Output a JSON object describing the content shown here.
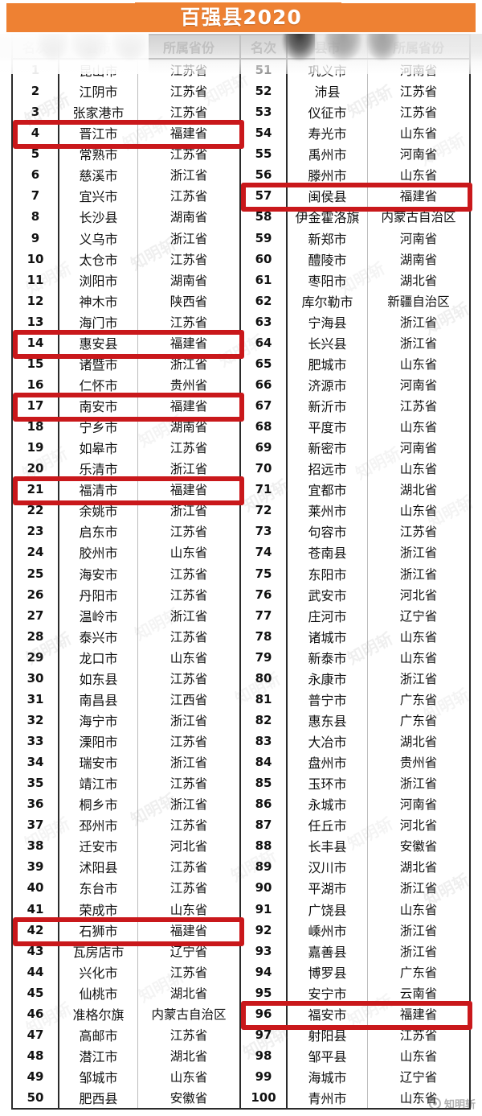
{
  "banner": {
    "title": "百强县2020",
    "background_color": "#ee8133",
    "title_color": "#ffffff"
  },
  "table": {
    "headers": {
      "rank": "名次",
      "city": "县市",
      "province": "所属省份"
    },
    "highlight_color": "#c9181b",
    "highlighted_ranks": [
      4,
      14,
      17,
      21,
      42,
      57,
      96
    ],
    "left_column": [
      {
        "rank": "1",
        "city": "昆山市",
        "province": "江苏省"
      },
      {
        "rank": "2",
        "city": "江阴市",
        "province": "江苏省"
      },
      {
        "rank": "3",
        "city": "张家港市",
        "province": "江苏省"
      },
      {
        "rank": "4",
        "city": "晋江市",
        "province": "福建省"
      },
      {
        "rank": "5",
        "city": "常熟市",
        "province": "江苏省"
      },
      {
        "rank": "6",
        "city": "慈溪市",
        "province": "浙江省"
      },
      {
        "rank": "7",
        "city": "宜兴市",
        "province": "江苏省"
      },
      {
        "rank": "8",
        "city": "长沙县",
        "province": "湖南省"
      },
      {
        "rank": "9",
        "city": "义乌市",
        "province": "浙江省"
      },
      {
        "rank": "10",
        "city": "太仓市",
        "province": "江苏省"
      },
      {
        "rank": "11",
        "city": "浏阳市",
        "province": "湖南省"
      },
      {
        "rank": "12",
        "city": "神木市",
        "province": "陕西省"
      },
      {
        "rank": "13",
        "city": "海门市",
        "province": "江苏省"
      },
      {
        "rank": "14",
        "city": "惠安县",
        "province": "福建省"
      },
      {
        "rank": "15",
        "city": "诸暨市",
        "province": "浙江省"
      },
      {
        "rank": "16",
        "city": "仁怀市",
        "province": "贵州省"
      },
      {
        "rank": "17",
        "city": "南安市",
        "province": "福建省"
      },
      {
        "rank": "18",
        "city": "宁乡市",
        "province": "湖南省"
      },
      {
        "rank": "19",
        "city": "如皋市",
        "province": "江苏省"
      },
      {
        "rank": "20",
        "city": "乐清市",
        "province": "浙江省"
      },
      {
        "rank": "21",
        "city": "福清市",
        "province": "福建省"
      },
      {
        "rank": "22",
        "city": "余姚市",
        "province": "浙江省"
      },
      {
        "rank": "23",
        "city": "启东市",
        "province": "江苏省"
      },
      {
        "rank": "24",
        "city": "胶州市",
        "province": "山东省"
      },
      {
        "rank": "25",
        "city": "海安市",
        "province": "江苏省"
      },
      {
        "rank": "26",
        "city": "丹阳市",
        "province": "江苏省"
      },
      {
        "rank": "27",
        "city": "温岭市",
        "province": "浙江省"
      },
      {
        "rank": "28",
        "city": "泰兴市",
        "province": "江苏省"
      },
      {
        "rank": "29",
        "city": "龙口市",
        "province": "山东省"
      },
      {
        "rank": "30",
        "city": "如东县",
        "province": "江苏省"
      },
      {
        "rank": "31",
        "city": "南昌县",
        "province": "江西省"
      },
      {
        "rank": "32",
        "city": "海宁市",
        "province": "浙江省"
      },
      {
        "rank": "33",
        "city": "溧阳市",
        "province": "江苏省"
      },
      {
        "rank": "34",
        "city": "瑞安市",
        "province": "浙江省"
      },
      {
        "rank": "35",
        "city": "靖江市",
        "province": "江苏省"
      },
      {
        "rank": "36",
        "city": "桐乡市",
        "province": "浙江省"
      },
      {
        "rank": "37",
        "city": "邳州市",
        "province": "江苏省"
      },
      {
        "rank": "38",
        "city": "迁安市",
        "province": "河北省"
      },
      {
        "rank": "39",
        "city": "沭阳县",
        "province": "江苏省"
      },
      {
        "rank": "40",
        "city": "东台市",
        "province": "江苏省"
      },
      {
        "rank": "41",
        "city": "荣成市",
        "province": "山东省"
      },
      {
        "rank": "42",
        "city": "石狮市",
        "province": "福建省"
      },
      {
        "rank": "43",
        "city": "瓦房店市",
        "province": "辽宁省"
      },
      {
        "rank": "44",
        "city": "兴化市",
        "province": "江苏省"
      },
      {
        "rank": "45",
        "city": "仙桃市",
        "province": "湖北省"
      },
      {
        "rank": "46",
        "city": "准格尔旗",
        "province": "内蒙古自治区"
      },
      {
        "rank": "47",
        "city": "高邮市",
        "province": "江苏省"
      },
      {
        "rank": "48",
        "city": "潜江市",
        "province": "湖北省"
      },
      {
        "rank": "49",
        "city": "邹城市",
        "province": "山东省"
      },
      {
        "rank": "50",
        "city": "肥西县",
        "province": "安徽省"
      }
    ],
    "right_column": [
      {
        "rank": "51",
        "city": "巩义市",
        "province": "河南省"
      },
      {
        "rank": "52",
        "city": "沛县",
        "province": "江苏省"
      },
      {
        "rank": "53",
        "city": "仪征市",
        "province": "江苏省"
      },
      {
        "rank": "54",
        "city": "寿光市",
        "province": "山东省"
      },
      {
        "rank": "55",
        "city": "禹州市",
        "province": "河南省"
      },
      {
        "rank": "56",
        "city": "滕州市",
        "province": "山东省"
      },
      {
        "rank": "57",
        "city": "闽侯县",
        "province": "福建省"
      },
      {
        "rank": "58",
        "city": "伊金霍洛旗",
        "province": "内蒙古自治区"
      },
      {
        "rank": "59",
        "city": "新郑市",
        "province": "河南省"
      },
      {
        "rank": "60",
        "city": "醴陵市",
        "province": "湖南省"
      },
      {
        "rank": "61",
        "city": "枣阳市",
        "province": "湖北省"
      },
      {
        "rank": "62",
        "city": "库尔勒市",
        "province": "新疆自治区"
      },
      {
        "rank": "63",
        "city": "宁海县",
        "province": "浙江省"
      },
      {
        "rank": "64",
        "city": "长兴县",
        "province": "浙江省"
      },
      {
        "rank": "65",
        "city": "肥城市",
        "province": "山东省"
      },
      {
        "rank": "66",
        "city": "济源市",
        "province": "河南省"
      },
      {
        "rank": "67",
        "city": "新沂市",
        "province": "江苏省"
      },
      {
        "rank": "68",
        "city": "平度市",
        "province": "山东省"
      },
      {
        "rank": "69",
        "city": "新密市",
        "province": "河南省"
      },
      {
        "rank": "70",
        "city": "招远市",
        "province": "山东省"
      },
      {
        "rank": "71",
        "city": "宜都市",
        "province": "湖北省"
      },
      {
        "rank": "72",
        "city": "莱州市",
        "province": "山东省"
      },
      {
        "rank": "73",
        "city": "句容市",
        "province": "江苏省"
      },
      {
        "rank": "74",
        "city": "苍南县",
        "province": "浙江省"
      },
      {
        "rank": "75",
        "city": "东阳市",
        "province": "浙江省"
      },
      {
        "rank": "76",
        "city": "武安市",
        "province": "河北省"
      },
      {
        "rank": "77",
        "city": "庄河市",
        "province": "辽宁省"
      },
      {
        "rank": "78",
        "city": "诸城市",
        "province": "山东省"
      },
      {
        "rank": "79",
        "city": "新泰市",
        "province": "山东省"
      },
      {
        "rank": "80",
        "city": "永康市",
        "province": "浙江省"
      },
      {
        "rank": "81",
        "city": "普宁市",
        "province": "广东省"
      },
      {
        "rank": "82",
        "city": "惠东县",
        "province": "广东省"
      },
      {
        "rank": "83",
        "city": "大冶市",
        "province": "湖北省"
      },
      {
        "rank": "84",
        "city": "盘州市",
        "province": "贵州省"
      },
      {
        "rank": "85",
        "city": "玉环市",
        "province": "浙江省"
      },
      {
        "rank": "86",
        "city": "永城市",
        "province": "河南省"
      },
      {
        "rank": "87",
        "city": "任丘市",
        "province": "河北省"
      },
      {
        "rank": "88",
        "city": "长丰县",
        "province": "安徽省"
      },
      {
        "rank": "89",
        "city": "汉川市",
        "province": "湖北省"
      },
      {
        "rank": "90",
        "city": "平湖市",
        "province": "浙江省"
      },
      {
        "rank": "91",
        "city": "广饶县",
        "province": "山东省"
      },
      {
        "rank": "92",
        "city": "嵊州市",
        "province": "浙江省"
      },
      {
        "rank": "93",
        "city": "嘉善县",
        "province": "浙江省"
      },
      {
        "rank": "94",
        "city": "博罗县",
        "province": "广东省"
      },
      {
        "rank": "95",
        "city": "安宁市",
        "province": "云南省"
      },
      {
        "rank": "96",
        "city": "福安市",
        "province": "福建省"
      },
      {
        "rank": "97",
        "city": "射阳县",
        "province": "江苏省"
      },
      {
        "rank": "98",
        "city": "邹平县",
        "province": "山东省"
      },
      {
        "rank": "99",
        "city": "海城市",
        "province": "辽宁省"
      },
      {
        "rank": "100",
        "city": "青州市",
        "province": "山东省"
      }
    ]
  },
  "watermarks": {
    "diagonal_text": "知明斩",
    "logo_text": "知明斩"
  }
}
